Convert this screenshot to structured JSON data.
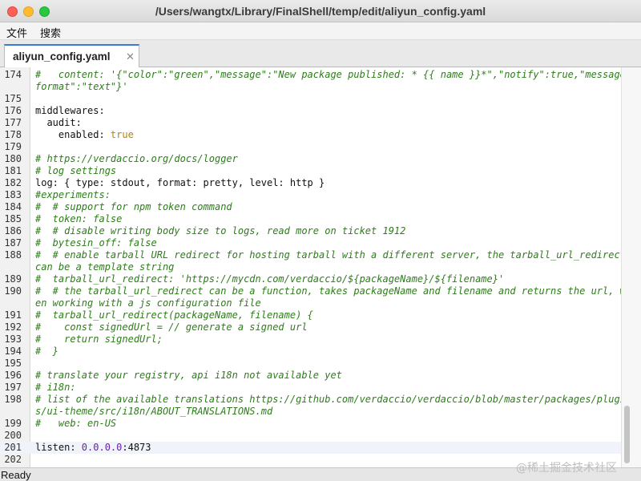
{
  "window": {
    "title": "/Users/wangtx/Library/FinalShell/temp/edit/aliyun_config.yaml"
  },
  "menu": {
    "file": "文件",
    "search": "搜索"
  },
  "tabs": [
    {
      "label": "aliyun_config.yaml",
      "close": "✕"
    }
  ],
  "editor": {
    "lines": [
      {
        "ln": "174",
        "segs": [
          {
            "t": "#   content: '{\"color\":\"green\",\"message\":\"New package published: * {{ name }}*\",\"notify\":true,\"message_",
            "c": "cmt"
          }
        ]
      },
      {
        "ln": "",
        "segs": [
          {
            "t": "format\":\"text\"}'",
            "c": "cmt"
          }
        ]
      },
      {
        "ln": "175",
        "segs": []
      },
      {
        "ln": "176",
        "segs": [
          {
            "t": "middlewares:",
            "c": ""
          }
        ]
      },
      {
        "ln": "177",
        "segs": [
          {
            "t": "  audit:",
            "c": ""
          }
        ]
      },
      {
        "ln": "178",
        "segs": [
          {
            "t": "    enabled: ",
            "c": ""
          },
          {
            "t": "true",
            "c": "val"
          }
        ]
      },
      {
        "ln": "179",
        "segs": []
      },
      {
        "ln": "180",
        "segs": [
          {
            "t": "# https://verdaccio.org/docs/logger",
            "c": "cmt"
          }
        ]
      },
      {
        "ln": "181",
        "segs": [
          {
            "t": "# log settings",
            "c": "cmt"
          }
        ]
      },
      {
        "ln": "182",
        "segs": [
          {
            "t": "log: { type: stdout, format: pretty, level: http }",
            "c": ""
          }
        ]
      },
      {
        "ln": "183",
        "segs": [
          {
            "t": "#experiments:",
            "c": "cmt"
          }
        ]
      },
      {
        "ln": "184",
        "segs": [
          {
            "t": "#  # support for npm token command",
            "c": "cmt"
          }
        ]
      },
      {
        "ln": "185",
        "segs": [
          {
            "t": "#  token: false",
            "c": "cmt"
          }
        ]
      },
      {
        "ln": "186",
        "segs": [
          {
            "t": "#  # disable writing body size to logs, read more on ticket 1912",
            "c": "cmt"
          }
        ]
      },
      {
        "ln": "187",
        "segs": [
          {
            "t": "#  bytesin_off: false",
            "c": "cmt"
          }
        ]
      },
      {
        "ln": "188",
        "segs": [
          {
            "t": "#  # enable tarball URL redirect for hosting tarball with a different server, the tarball_url_redirect",
            "c": "cmt"
          }
        ]
      },
      {
        "ln": "",
        "segs": [
          {
            "t": "can be a template string",
            "c": "cmt"
          }
        ]
      },
      {
        "ln": "189",
        "segs": [
          {
            "t": "#  tarball_url_redirect: 'https://mycdn.com/verdaccio/${packageName}/${filename}'",
            "c": "cmt"
          }
        ]
      },
      {
        "ln": "190",
        "segs": [
          {
            "t": "#  # the tarball_url_redirect can be a function, takes packageName and filename and returns the url, wh",
            "c": "cmt"
          }
        ]
      },
      {
        "ln": "",
        "segs": [
          {
            "t": "en working with a js configuration file",
            "c": "cmt"
          }
        ]
      },
      {
        "ln": "191",
        "segs": [
          {
            "t": "#  tarball_url_redirect(packageName, filename) {",
            "c": "cmt"
          }
        ]
      },
      {
        "ln": "192",
        "segs": [
          {
            "t": "#    const signedUrl = // generate a signed url",
            "c": "cmt"
          }
        ]
      },
      {
        "ln": "193",
        "segs": [
          {
            "t": "#    return signedUrl;",
            "c": "cmt"
          }
        ]
      },
      {
        "ln": "194",
        "segs": [
          {
            "t": "#  }",
            "c": "cmt"
          }
        ]
      },
      {
        "ln": "195",
        "segs": []
      },
      {
        "ln": "196",
        "segs": [
          {
            "t": "# translate your registry, api i18n not available yet",
            "c": "cmt"
          }
        ]
      },
      {
        "ln": "197",
        "segs": [
          {
            "t": "# i18n:",
            "c": "cmt"
          }
        ]
      },
      {
        "ln": "198",
        "segs": [
          {
            "t": "# list of the available translations https://github.com/verdaccio/verdaccio/blob/master/packages/plugin",
            "c": "cmt"
          }
        ]
      },
      {
        "ln": "",
        "segs": [
          {
            "t": "s/ui-theme/src/i18n/ABOUT_TRANSLATIONS.md",
            "c": "cmt"
          }
        ]
      },
      {
        "ln": "199",
        "segs": [
          {
            "t": "#   web: en-US",
            "c": "cmt"
          }
        ]
      },
      {
        "ln": "200",
        "segs": []
      },
      {
        "ln": "201",
        "segs": [
          {
            "t": "listen: ",
            "c": ""
          },
          {
            "t": "0.0.0.0",
            "c": "num"
          },
          {
            "t": ":4873",
            "c": ""
          }
        ],
        "current": true
      },
      {
        "ln": "202",
        "segs": []
      }
    ]
  },
  "status": {
    "text": "Ready"
  },
  "watermark": "@稀土掘金技术社区",
  "colors": {
    "comment": "#2d7d1a",
    "value": "#b68400",
    "number": "#6a1fb0",
    "tab_accent": "#3a7bd5"
  }
}
